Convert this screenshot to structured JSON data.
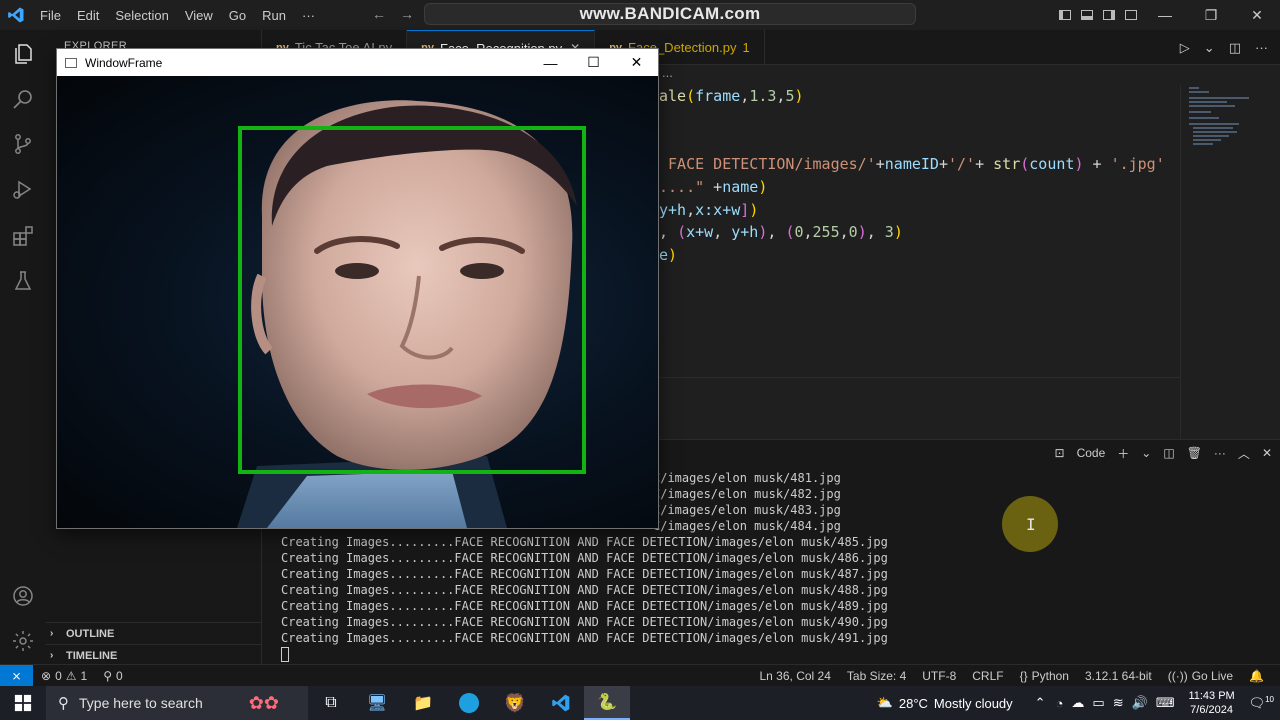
{
  "titlebar": {
    "menus": [
      "File",
      "Edit",
      "Selection",
      "View",
      "Go",
      "Run",
      "···"
    ],
    "search_text": "www.BANDICAM.com"
  },
  "sidebar": {
    "title": "EXPLORER",
    "sections": [
      "OUTLINE",
      "TIMELINE"
    ]
  },
  "tabs": [
    {
      "label": "Tic Tac Toe AI.py",
      "active": false
    },
    {
      "label": "Face_Recognition.py",
      "active": true
    },
    {
      "label": "Face_Detection.py",
      "active": false,
      "badge": "1"
    }
  ],
  "breadcrumb": "...",
  "editor": {
    "lines": [
      {
        "parts": [
          [
            "fn",
            "ale"
          ],
          [
            "brk2",
            "("
          ],
          [
            "var",
            "frame"
          ],
          [
            "pun",
            ","
          ],
          [
            "num",
            "1.3"
          ],
          [
            "pun",
            ","
          ],
          [
            "num",
            "5"
          ],
          [
            "brk2",
            ")"
          ]
        ]
      },
      {
        "parts": [
          [
            "str",
            " FACE DETECTION/images/'"
          ],
          [
            "pun",
            "+"
          ],
          [
            "var",
            "nameID"
          ],
          [
            "pun",
            "+"
          ],
          [
            "str",
            "'/'"
          ],
          [
            "pun",
            "+ "
          ],
          [
            "fn",
            "str"
          ],
          [
            "brk",
            "("
          ],
          [
            "var",
            "count"
          ],
          [
            "brk",
            ")"
          ],
          [
            "pun",
            " + "
          ],
          [
            "str",
            "'.jpg'"
          ]
        ]
      },
      {
        "parts": [
          [
            "str",
            "....\""
          ],
          [
            "pun",
            " +"
          ],
          [
            "var",
            "name"
          ],
          [
            "brk2",
            ")"
          ]
        ]
      },
      {
        "parts": [
          [
            "var",
            "y+h"
          ],
          [
            "pun",
            ","
          ],
          [
            "var",
            "x:x+w"
          ],
          [
            "brk",
            "]"
          ],
          [
            "brk2",
            ")"
          ]
        ]
      },
      {
        "parts": [
          [
            "pun",
            ", "
          ],
          [
            "brk",
            "("
          ],
          [
            "var",
            "x+w"
          ],
          [
            "pun",
            ", "
          ],
          [
            "var",
            "y+h"
          ],
          [
            "brk",
            ")"
          ],
          [
            "pun",
            ", "
          ],
          [
            "brk",
            "("
          ],
          [
            "num",
            "0"
          ],
          [
            "pun",
            ","
          ],
          [
            "num",
            "255"
          ],
          [
            "pun",
            ","
          ],
          [
            "num",
            "0"
          ],
          [
            "brk",
            ")"
          ],
          [
            "pun",
            ", "
          ],
          [
            "num",
            "3"
          ],
          [
            "brk2",
            ")"
          ]
        ]
      },
      {
        "parts": [
          [
            "var",
            "e"
          ],
          [
            "brk2",
            ")"
          ]
        ]
      }
    ]
  },
  "panel": {
    "shell_label": "Code",
    "partial_lines": [
      "C/images/elon musk/481.jpg",
      "C/images/elon musk/482.jpg",
      "C/images/elon musk/483.jpg",
      "C/images/elon musk/484.jpg"
    ],
    "lines": [
      "Creating Images.........FACE RECOGNITION AND FACE DETECTION/images/elon musk/485.jpg",
      "Creating Images.........FACE RECOGNITION AND FACE DETECTION/images/elon musk/486.jpg",
      "Creating Images.........FACE RECOGNITION AND FACE DETECTION/images/elon musk/487.jpg",
      "Creating Images.........FACE RECOGNITION AND FACE DETECTION/images/elon musk/488.jpg",
      "Creating Images.........FACE RECOGNITION AND FACE DETECTION/images/elon musk/489.jpg",
      "Creating Images.........FACE RECOGNITION AND FACE DETECTION/images/elon musk/490.jpg",
      "Creating Images.........FACE RECOGNITION AND FACE DETECTION/images/elon musk/491.jpg"
    ],
    "cursor_char": "I"
  },
  "cv_window": {
    "title": "WindowFrame",
    "box_color": "#12b312"
  },
  "statusbar": {
    "errors": "0",
    "warnings": "1",
    "ports": "0",
    "position": "Ln 36, Col 24",
    "tab_size": "Tab Size: 4",
    "encoding": "UTF-8",
    "eol": "CRLF",
    "language": "Python",
    "interpreter": "3.12.1 64-bit",
    "go_live": "Go Live"
  },
  "taskbar": {
    "search_placeholder": "Type here to search",
    "temperature": "28°C",
    "weather": "Mostly cloudy",
    "time": "11:43 PM",
    "date": "7/6/2024",
    "notif_count": "10"
  },
  "colors": {
    "accent": "#0078d4",
    "face_box": "#12b312"
  }
}
